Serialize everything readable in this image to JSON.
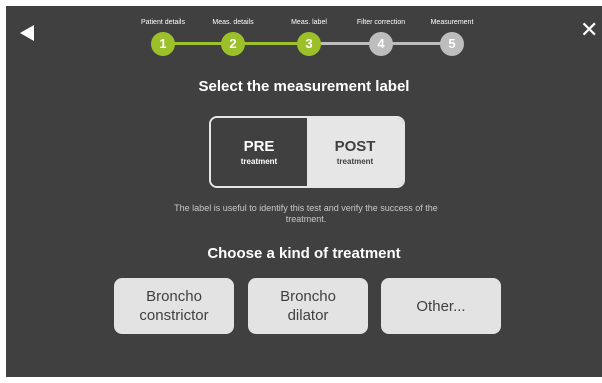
{
  "colors": {
    "background": "#404040",
    "step_done": "#9bc02a",
    "step_pending": "#bdbdbd",
    "button_bg": "#e3e3e3"
  },
  "header": {
    "back_icon": "back-triangle-icon",
    "close_label": "✕"
  },
  "steps": [
    {
      "label": "Patient details",
      "number": "1",
      "status": "done"
    },
    {
      "label": "Meas. details",
      "number": "2",
      "status": "done"
    },
    {
      "label": "Meas. label",
      "number": "3",
      "status": "current"
    },
    {
      "label": "Filter correction",
      "number": "4",
      "status": "pending"
    },
    {
      "label": "Measurement",
      "number": "5",
      "status": "pending"
    }
  ],
  "main": {
    "title": "Select the measurement label",
    "label_options": [
      {
        "main": "PRE",
        "sub": "treatment",
        "selected": true
      },
      {
        "main": "POST",
        "sub": "treatment",
        "selected": false
      }
    ],
    "hint": "The label is useful to identify this test and verify the success of the treatment.",
    "subtitle": "Choose a kind of treatment",
    "treatments": [
      {
        "label": "Broncho\nconstrictor"
      },
      {
        "label": "Broncho\ndilator"
      },
      {
        "label": "Other..."
      }
    ]
  }
}
